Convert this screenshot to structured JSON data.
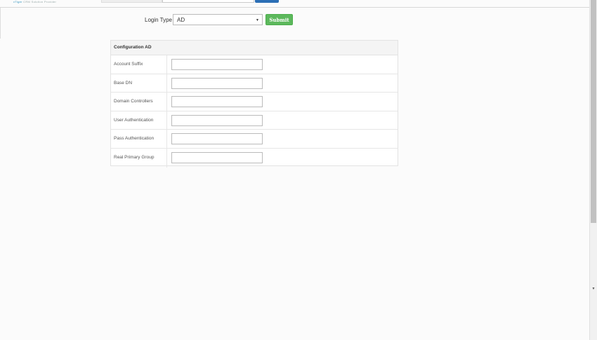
{
  "header": {
    "brand_prefix": "vTiger",
    "brand_suffix": " CRM Solution Provider"
  },
  "login": {
    "label": "Login Type",
    "selected": "AD",
    "submit_label": "Submit"
  },
  "config": {
    "title": "Configuration AD",
    "rows": [
      {
        "label": "Account Suffix",
        "value": ""
      },
      {
        "label": "Base DN",
        "value": ""
      },
      {
        "label": "Domain Controllers",
        "value": ""
      },
      {
        "label": "User Authentication",
        "value": ""
      },
      {
        "label": "Pass Authentication",
        "value": ""
      },
      {
        "label": "Real Primary Group",
        "value": ""
      }
    ]
  },
  "colors": {
    "submit": "#5cb85c",
    "header_button": "#2c6fb5"
  }
}
